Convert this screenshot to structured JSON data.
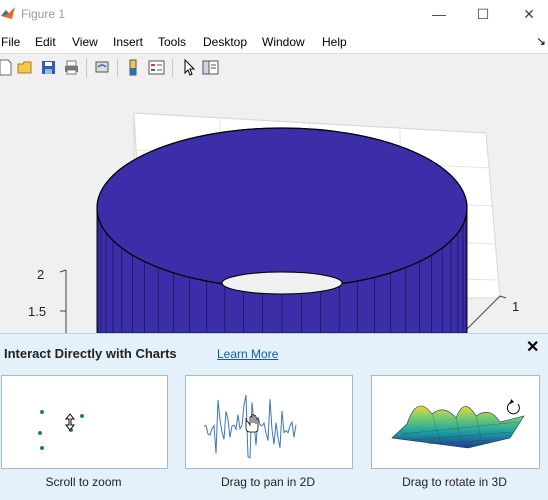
{
  "window": {
    "title": "Figure 1",
    "minimize_icon": "minimize-icon",
    "maximize_icon": "maximize-icon",
    "close_icon": "close-icon"
  },
  "menu": [
    "File",
    "Edit",
    "View",
    "Insert",
    "Tools",
    "Desktop",
    "Window",
    "Help"
  ],
  "toolbar_icons": [
    "new-figure-icon",
    "open-icon",
    "save-icon",
    "print-icon",
    "link-icon",
    "colorbar-icon",
    "legend-icon",
    "pointer-icon",
    "property-editor-icon"
  ],
  "axes": {
    "z_ticks": [
      "2",
      "1.5"
    ],
    "y_ticks": [
      "1"
    ],
    "face_color": "#3c2ea8"
  },
  "banner": {
    "title": "Interact Directly with Charts",
    "learn_more": "Learn More",
    "cards": [
      {
        "caption": "Scroll to zoom",
        "icon": "scroll-zoom-icon"
      },
      {
        "caption": "Drag to pan in 2D",
        "icon": "pan-hand-icon"
      },
      {
        "caption": "Drag to rotate in 3D",
        "icon": "rotate-icon"
      }
    ]
  }
}
